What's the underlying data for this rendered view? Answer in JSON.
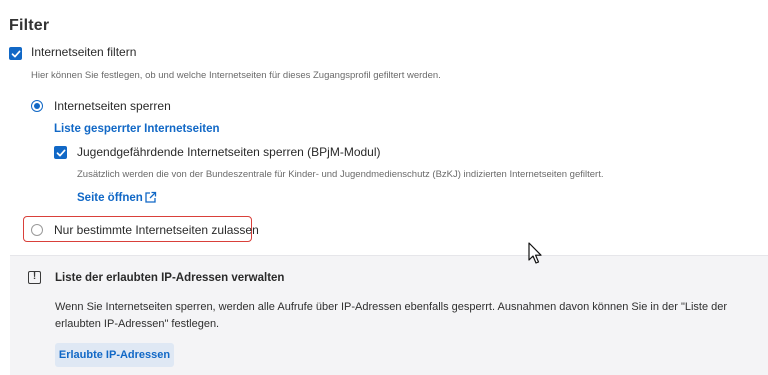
{
  "section": {
    "title": "Filter"
  },
  "filter": {
    "checkbox_label": "Internetseiten filtern",
    "description": "Hier können Sie festlegen, ob und welche Internetseiten für dieses Zugangsprofil gefiltert werden.",
    "options": {
      "block": {
        "label": "Internetseiten sperren",
        "selected": true,
        "list_link": "Liste gesperrter Internetseiten",
        "bpjm_label": "Jugendgefährdende Internetseiten sperren (BPjM-Modul)",
        "bpjm_checked": true,
        "bpjm_description": "Zusätzlich werden die von der Bundeszentrale für Kinder- und Jugendmedienschutz (BzKJ) indizierten Internetseiten gefiltert.",
        "open_page_link": "Seite öffnen"
      },
      "allow": {
        "label": "Nur bestimmte Internetseiten zulassen",
        "selected": false
      }
    }
  },
  "info_panel": {
    "title": "Liste der erlaubten IP-Adressen verwalten",
    "text": "Wenn Sie Internetseiten sperren, werden alle Aufrufe über IP-Adressen ebenfalls gesperrt. Ausnahmen davon können Sie in der \"Liste der erlaubten IP-Adressen\" festlegen.",
    "button_label": "Erlaubte IP-Adressen"
  },
  "icons": {
    "checkbox": "checkmark-icon",
    "external": "external-link-icon",
    "info": "exclamation-icon",
    "cursor": "mouse-cursor-icon"
  },
  "colors": {
    "accent": "#1168c6",
    "highlight": "#d9403a",
    "panel_bg": "#f4f4f6"
  }
}
